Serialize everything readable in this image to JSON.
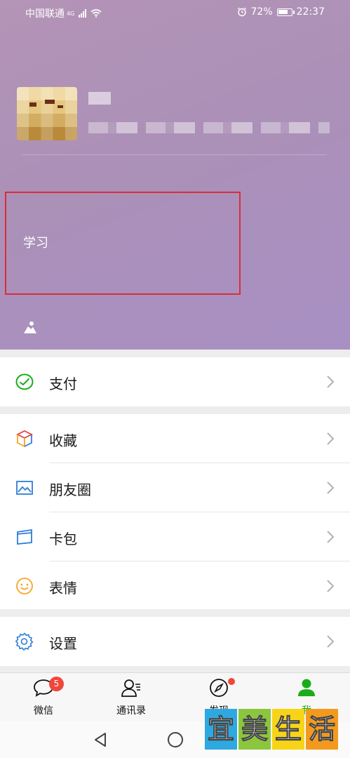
{
  "status_bar": {
    "carrier": "中国联通",
    "network_tag": "4G",
    "battery": "72%",
    "time": "22:37"
  },
  "profile": {
    "status_text": "学习"
  },
  "menu": {
    "pay": "支付",
    "favorites": "收藏",
    "moments": "朋友圈",
    "cards": "卡包",
    "stickers": "表情",
    "settings": "设置"
  },
  "tabbar": {
    "chats": {
      "label": "微信",
      "badge": "5"
    },
    "contacts": {
      "label": "通讯录"
    },
    "discover": {
      "label": "发现"
    },
    "me": {
      "label": "我"
    }
  },
  "watermark": {
    "chars": [
      "宜",
      "美",
      "生",
      "活"
    ]
  },
  "colors": {
    "accent": "#1aad19",
    "badge": "#f0473c",
    "highlight_box": "#d92d3a"
  }
}
